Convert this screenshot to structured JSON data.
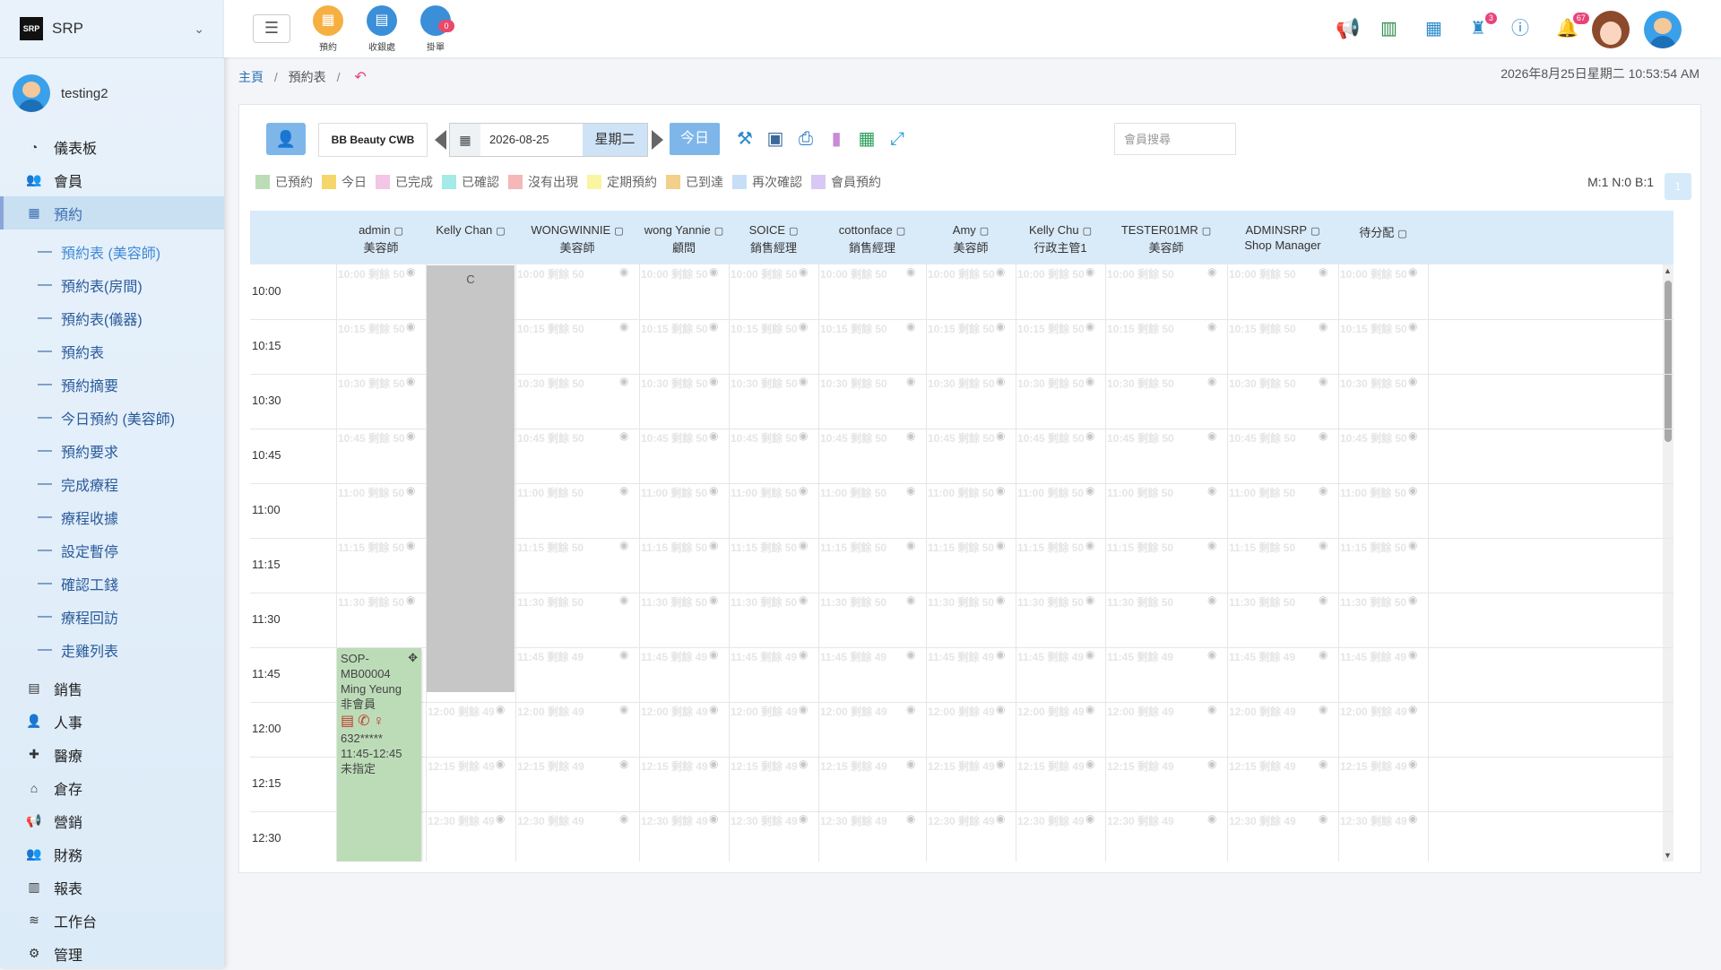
{
  "sidebar": {
    "brand": "SRP",
    "logo_text": "SRP",
    "user": "testing2",
    "menu": [
      {
        "label": "儀表板",
        "icon": "dashboard-icon",
        "glyph": "◔"
      },
      {
        "label": "會員",
        "icon": "users-icon",
        "glyph": "👥"
      },
      {
        "label": "預約",
        "icon": "calendar-icon",
        "glyph": "▦"
      }
    ],
    "submenu": [
      "預約表 (美容師)",
      "預約表(房間)",
      "預約表(儀器)",
      "預約表",
      "預約摘要",
      "今日預約 (美容師)",
      "預約要求",
      "完成療程",
      "療程收據",
      "設定暫停",
      "確認工錢",
      "療程回訪",
      "走雞列表"
    ],
    "menu2": [
      {
        "label": "銷售",
        "icon": "sales-icon",
        "glyph": "▤"
      },
      {
        "label": "人事",
        "icon": "person-icon",
        "glyph": "👤"
      },
      {
        "label": "醫療",
        "icon": "medical-icon",
        "glyph": "✚"
      },
      {
        "label": "倉存",
        "icon": "warehouse-icon",
        "glyph": "⌂"
      },
      {
        "label": "營銷",
        "icon": "megaphone-icon",
        "glyph": "📢"
      },
      {
        "label": "財務",
        "icon": "finance-icon",
        "glyph": "👥"
      },
      {
        "label": "報表",
        "icon": "report-icon",
        "glyph": "▥"
      },
      {
        "label": "工作台",
        "icon": "layers-icon",
        "glyph": "≋"
      },
      {
        "label": "管理",
        "icon": "gear-icon",
        "glyph": "⚙"
      }
    ]
  },
  "topbar": {
    "quick": [
      {
        "label": "預約",
        "color": "#f5b041",
        "glyph": "▦",
        "badge": ""
      },
      {
        "label": "收銀處",
        "color": "#3b8fd9",
        "glyph": "▤",
        "badge": ""
      },
      {
        "label": "掛單",
        "color": "#3b8fd9",
        "glyph": "",
        "badge": "0"
      }
    ],
    "badges": {
      "staff": "3",
      "bell": "67"
    }
  },
  "breadcrumb": {
    "home": "主頁",
    "page": "預約表"
  },
  "datetime": "2026年8月25日星期二 10:53:54 AM",
  "toolbar": {
    "shop": "BB Beauty CWB",
    "date": "2026-08-25",
    "weekday": "星期二",
    "today": "今日",
    "search_placeholder": "會員搜尋"
  },
  "legend": [
    {
      "label": "已預約",
      "color": "#bcdcb8"
    },
    {
      "label": "今日",
      "color": "#f5d66b"
    },
    {
      "label": "已完成",
      "color": "#f3c6e6"
    },
    {
      "label": "已確認",
      "color": "#a4eae6"
    },
    {
      "label": "沒有出現",
      "color": "#f5b7b7"
    },
    {
      "label": "定期預約",
      "color": "#f9f5a0"
    },
    {
      "label": "已到達",
      "color": "#f2d08a"
    },
    {
      "label": "再次確認",
      "color": "#c7def7"
    },
    {
      "label": "會員預約",
      "color": "#d9c8f3"
    }
  ],
  "counts": "M:1 N:0 B:1",
  "mini_button": "1",
  "columns": [
    {
      "name": "admin",
      "role": "美容師"
    },
    {
      "name": "Kelly Chan",
      "role": ""
    },
    {
      "name": "WONGWINNIE",
      "role": "美容師"
    },
    {
      "name": "wong Yannie",
      "role": "顧問"
    },
    {
      "name": "SOICE",
      "role": "銷售經理"
    },
    {
      "name": "cottonface",
      "role": "銷售經理"
    },
    {
      "name": "Amy",
      "role": "美容師"
    },
    {
      "name": "Kelly Chu",
      "role": "行政主管1"
    },
    {
      "name": "TESTER01MR",
      "role": "美容師"
    },
    {
      "name": "ADMINSRP",
      "role": "Shop Manager"
    },
    {
      "name": "待分配",
      "role": ""
    }
  ],
  "times": [
    "10:00",
    "10:15",
    "10:30",
    "10:45",
    "11:00",
    "11:15",
    "11:30",
    "11:45",
    "12:00",
    "12:15",
    "12:30"
  ],
  "slot_remaining": [
    50,
    50,
    50,
    50,
    50,
    50,
    50,
    49,
    49,
    49,
    49
  ],
  "slot_word": "剩餘",
  "blocked": {
    "label": "C"
  },
  "appointment": {
    "code": "SOP-MB00004",
    "name": "Ming Yeung",
    "type": "非會員",
    "phone": "632*****",
    "time": "11:45-12:45",
    "staff": "未指定"
  }
}
